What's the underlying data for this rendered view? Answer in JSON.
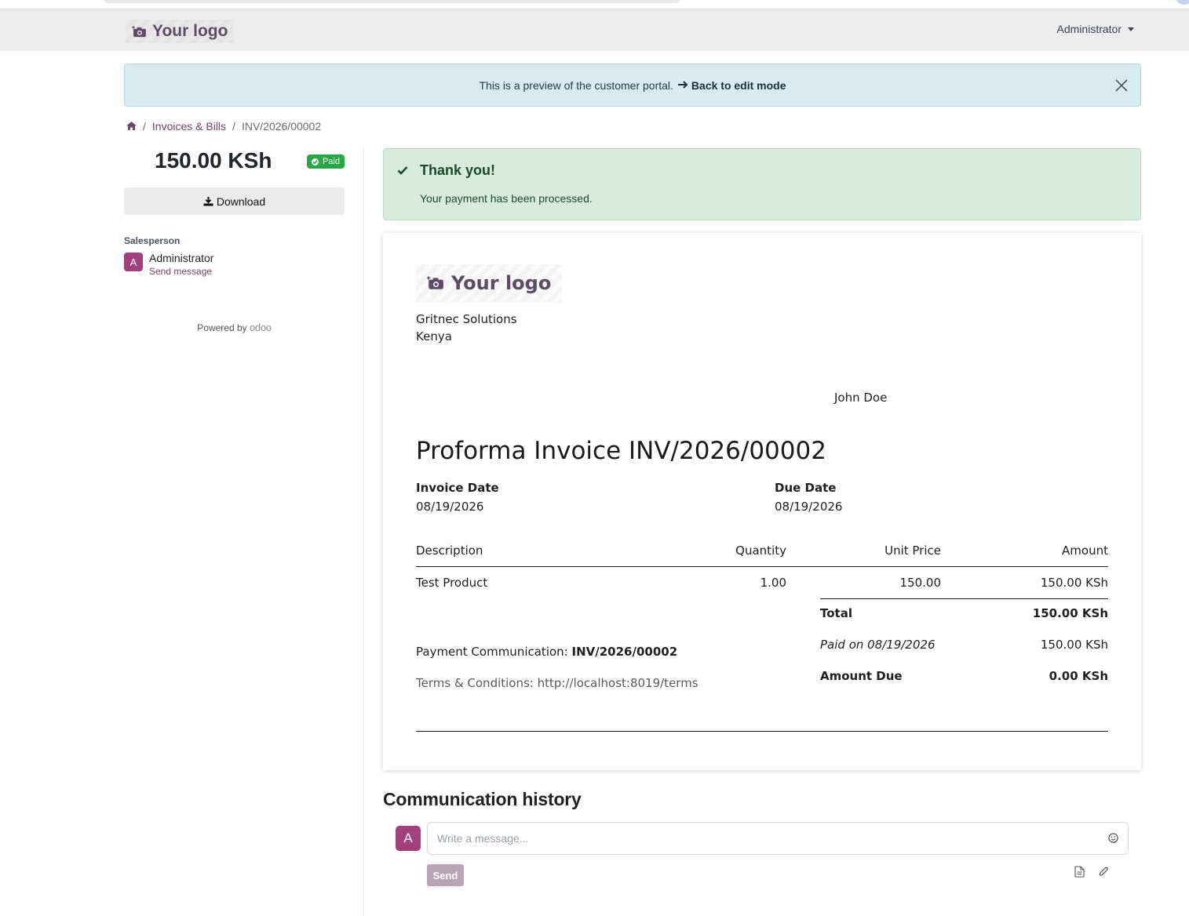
{
  "header": {
    "logo_text": "Your logo",
    "user_menu": "Administrator"
  },
  "preview_banner": {
    "text": "This is a preview of the customer portal.",
    "link_label": "Back to edit mode"
  },
  "breadcrumb": {
    "items": [
      "Invoices & Bills",
      "INV/2026/00002"
    ]
  },
  "sidebar": {
    "amount": "150.00 KSh",
    "status_badge": "Paid",
    "download_label": "Download",
    "salesperson_label": "Salesperson",
    "salesperson_initial": "A",
    "salesperson_name": "Administrator",
    "send_message_label": "Send message",
    "powered_by": "Powered by",
    "powered_brand": "odoo"
  },
  "payment_alert": {
    "title": "Thank you!",
    "message": "Your payment has been processed."
  },
  "invoice": {
    "logo_text": "Your logo",
    "company_name": "Gritnec Solutions",
    "company_country": "Kenya",
    "customer_name": "John Doe",
    "title": "Proforma Invoice INV/2026/00002",
    "invoice_date_label": "Invoice Date",
    "invoice_date": "08/19/2026",
    "due_date_label": "Due Date",
    "due_date": "08/19/2026",
    "columns": {
      "description": "Description",
      "quantity": "Quantity",
      "unit_price": "Unit Price",
      "amount": "Amount"
    },
    "lines": [
      {
        "description": "Test Product",
        "quantity": "1.00",
        "unit_price": "150.00",
        "amount": "150.00 KSh"
      }
    ],
    "totals": {
      "total_label": "Total",
      "total_value": "150.00 KSh",
      "paid_label": "Paid on 08/19/2026",
      "paid_value": "150.00 KSh",
      "due_label": "Amount Due",
      "due_value": "0.00 KSh"
    },
    "payment_communication_label": "Payment Communication:",
    "payment_communication_ref": "INV/2026/00002",
    "terms": "Terms & Conditions: http://localhost:8019/terms"
  },
  "communication": {
    "title": "Communication history",
    "avatar_initial": "A",
    "composer_placeholder": "Write a message...",
    "send_label": "Send"
  },
  "colors": {
    "brand_purple": "#71466b",
    "avatar": "#a23f7d",
    "paid_green": "#28a745",
    "info_bg": "#d7ebf1",
    "success_bg": "#d8ecdc"
  },
  "icons": {
    "home": "home-icon",
    "close": "close-icon",
    "download": "download-icon",
    "check": "check-icon",
    "camera": "camera-icon",
    "emoji": "emoji-icon",
    "file": "file-icon",
    "paperclip": "paperclip-icon"
  }
}
